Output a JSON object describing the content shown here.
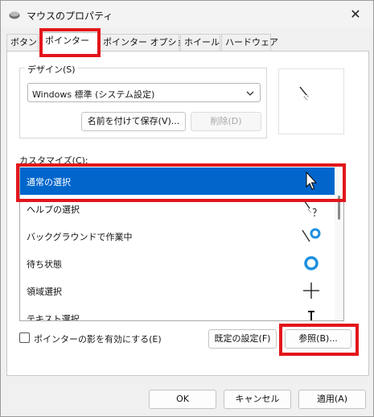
{
  "window": {
    "title": "マウスのプロパティ",
    "close_glyph": "✕"
  },
  "tabs": [
    {
      "label": "ボタン"
    },
    {
      "label": "ポインター",
      "active": true
    },
    {
      "label": "ポインター オプション"
    },
    {
      "label": "ホイール"
    },
    {
      "label": "ハードウェア"
    }
  ],
  "design": {
    "group_label": "デザイン(S)",
    "scheme_value": "Windows 標準 (システム設定)",
    "save_as_label": "名前を付けて保存(V)...",
    "delete_label": "削除(D)"
  },
  "customize": {
    "label": "カスタマイズ(C):",
    "rows": [
      {
        "label": "通常の選択",
        "icon": "arrow-cursor-icon",
        "selected": true
      },
      {
        "label": "ヘルプの選択",
        "icon": "help-cursor-icon"
      },
      {
        "label": "バックグラウンドで作業中",
        "icon": "working-in-background-cursor-icon"
      },
      {
        "label": "待ち状態",
        "icon": "busy-cursor-icon"
      },
      {
        "label": "領域選択",
        "icon": "crosshair-cursor-icon"
      },
      {
        "label": "テキスト選択",
        "icon": "text-select-cursor-icon"
      }
    ]
  },
  "shadow_checkbox": {
    "label": "ポインターの影を有効にする(E)",
    "checked": false
  },
  "buttons": {
    "use_default": "既定の設定(F)",
    "browse": "参照(B)...",
    "ok": "OK",
    "cancel": "キャンセル",
    "apply": "適用(A)"
  },
  "colors": {
    "selection": "#0066cc",
    "highlight": "#e2161b"
  }
}
